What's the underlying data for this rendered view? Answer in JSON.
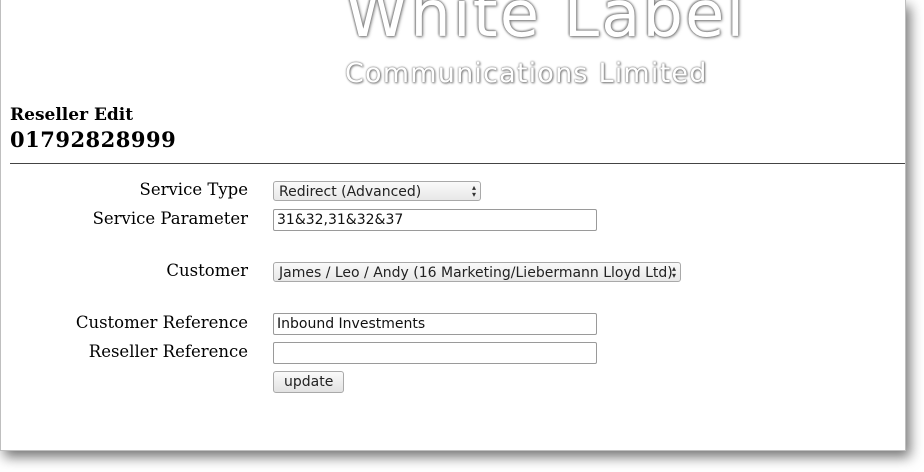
{
  "brand": {
    "line1": "White Label",
    "line2": "Communications Limited"
  },
  "page": {
    "heading": "Reseller Edit",
    "number": "01792828999"
  },
  "form": {
    "service_type": {
      "label": "Service Type",
      "value": "Redirect (Advanced)"
    },
    "service_parameter": {
      "label": "Service Parameter",
      "value": "31&32,31&32&37"
    },
    "customer": {
      "label": "Customer",
      "value": "James / Leo / Andy (16 Marketing/Liebermann Lloyd Ltd)"
    },
    "customer_reference": {
      "label": "Customer Reference",
      "value": "Inbound Investments"
    },
    "reseller_reference": {
      "label": "Reseller Reference",
      "value": ""
    },
    "submit_label": "update"
  },
  "icons": {
    "select_arrow": "up-down-chevron-icon"
  }
}
